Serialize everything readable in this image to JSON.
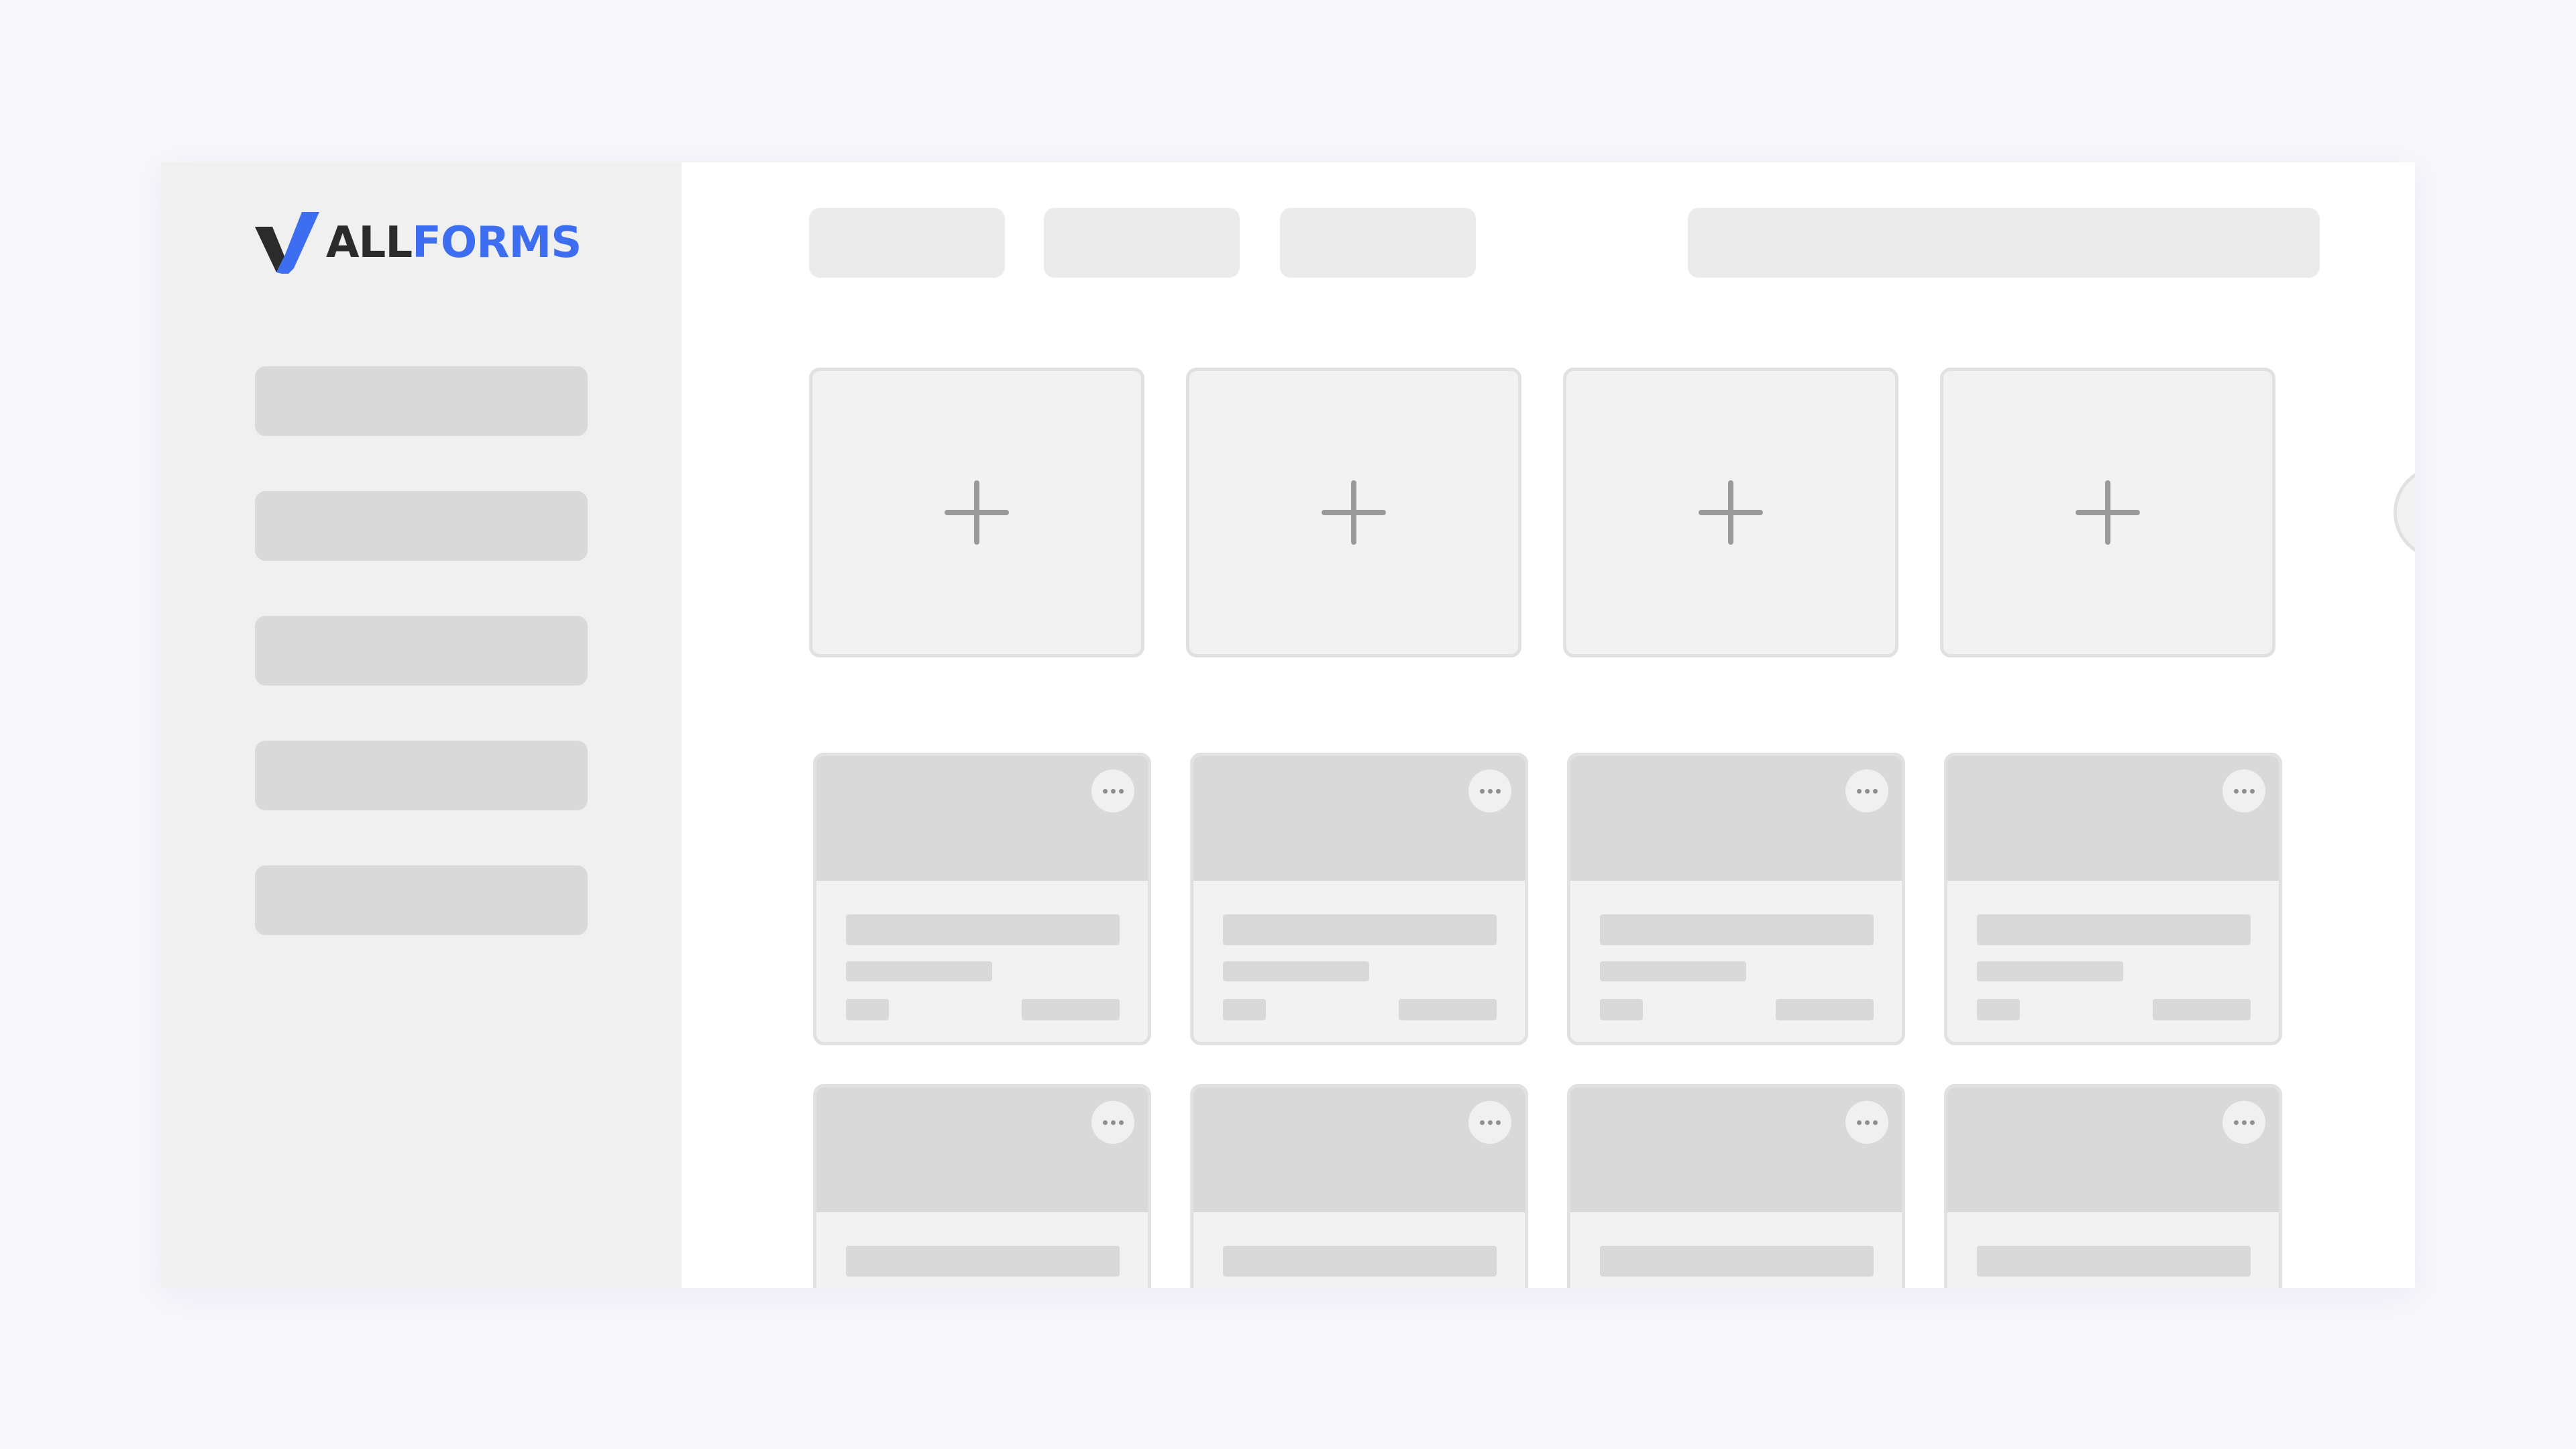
{
  "brand": {
    "name_part1": "ALL",
    "name_part2": "FORMS",
    "color_dark": "#2b2b2b",
    "color_accent": "#3d6ef2"
  },
  "sidebar": {
    "items": [
      "",
      "",
      "",
      "",
      ""
    ]
  },
  "toolbar": {
    "pills": [
      "",
      "",
      ""
    ],
    "search": "",
    "avatar": ""
  },
  "templates": {
    "icon": "plus-icon",
    "count": 4,
    "next_icon": "chevron-right-icon"
  },
  "forms": {
    "menu_icon": "more-horizontal-icon",
    "rows": 2,
    "per_row": 4
  },
  "colors": {
    "background": "#f7f7fc",
    "sidebar": "#f0f0f0",
    "placeholder": "#d9d9d9",
    "card": "#f2f2f2",
    "border": "#e1e1e1",
    "icon": "#9a9a9a"
  }
}
